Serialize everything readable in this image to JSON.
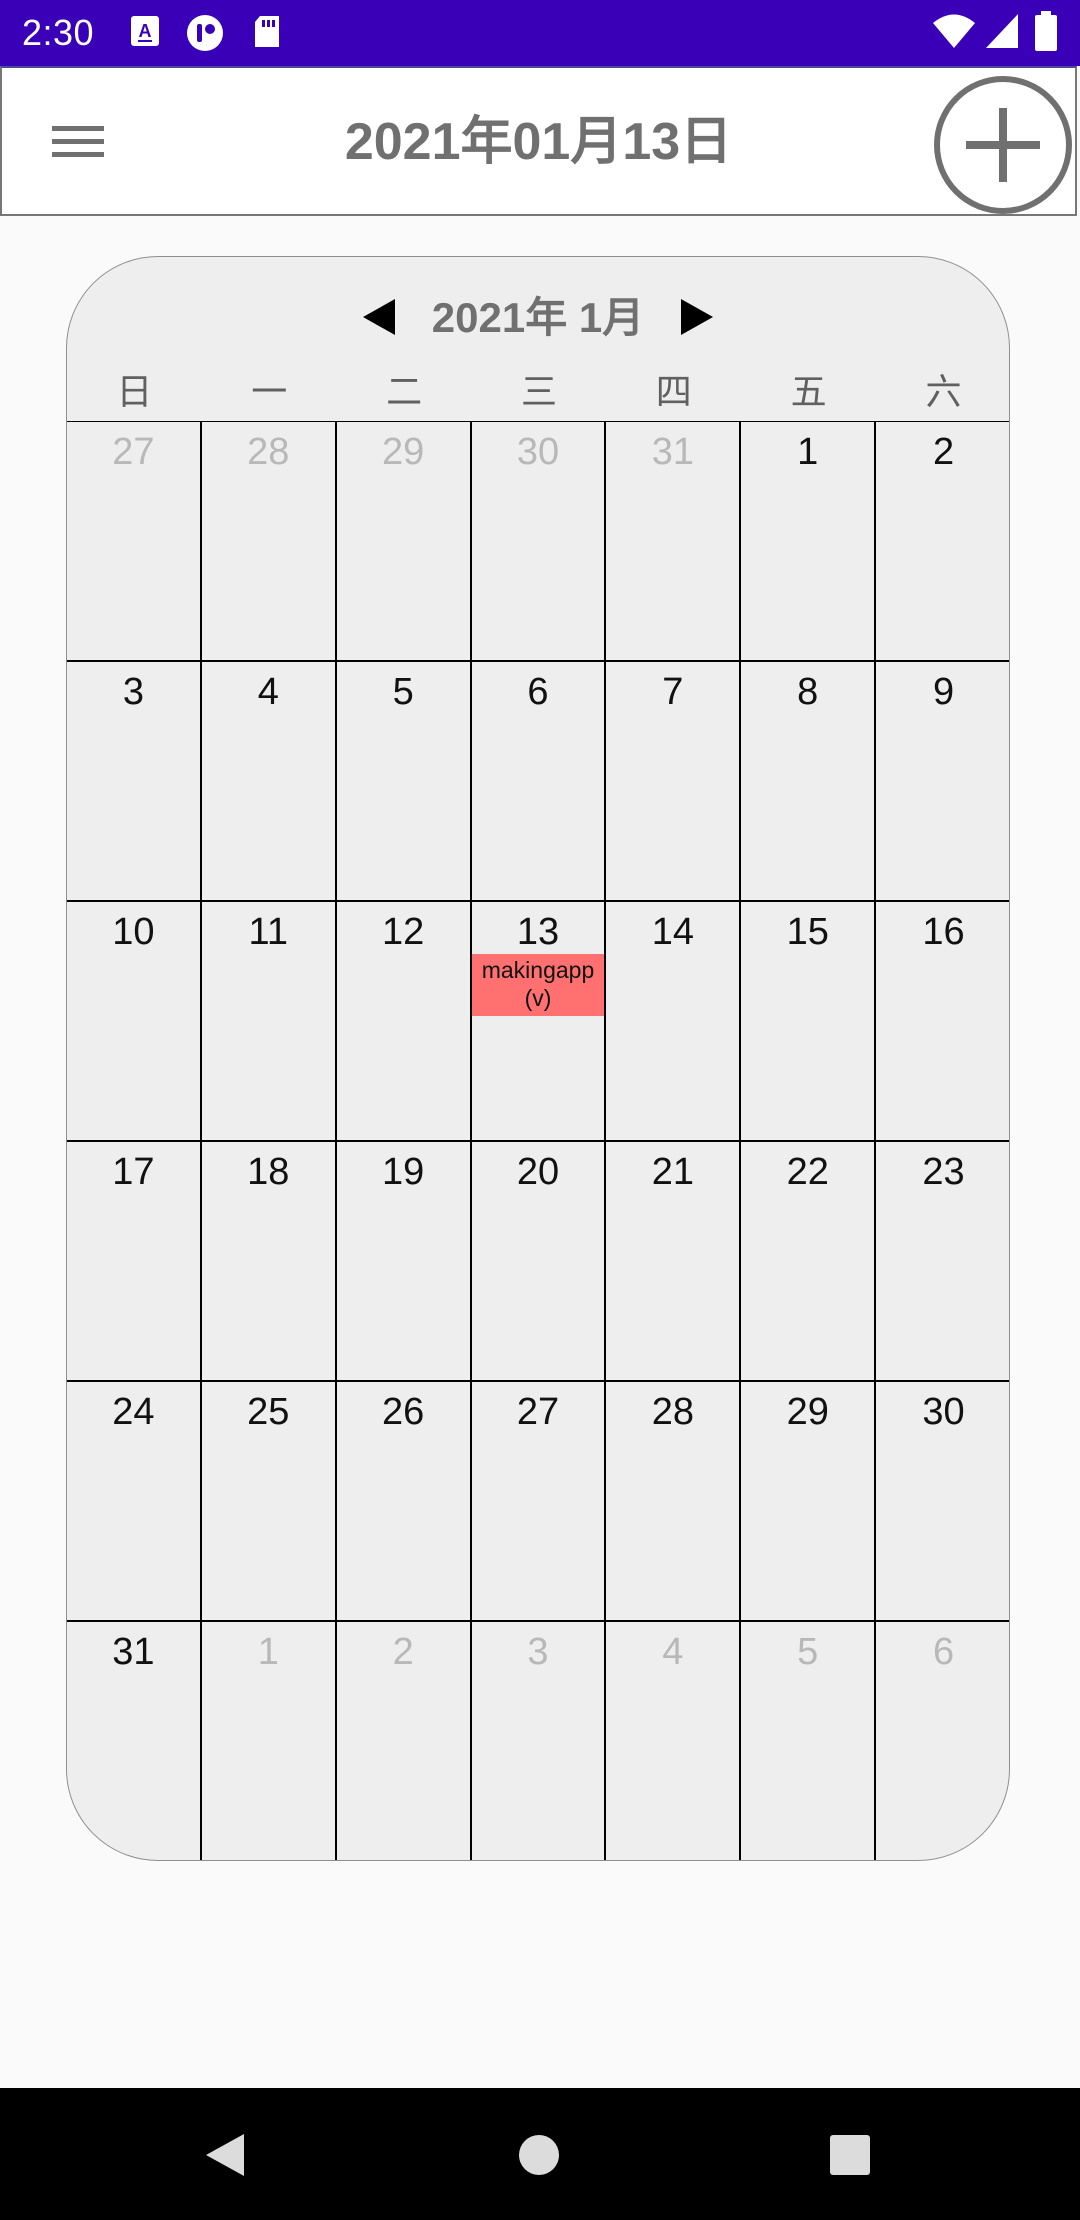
{
  "status_bar": {
    "time": "2:30",
    "icons": [
      "keyboard-a-icon",
      "app-notification-icon",
      "sd-card-icon",
      "wifi-icon",
      "cell-signal-icon",
      "battery-icon"
    ]
  },
  "app_bar": {
    "title": "2021年01月13日",
    "menu_icon": "hamburger-menu-icon",
    "add_icon": "plus-circle-icon"
  },
  "calendar": {
    "month_label": "2021年 1月",
    "prev_icon": "triangle-left-icon",
    "next_icon": "triangle-right-icon",
    "weekdays": [
      "日",
      "一",
      "二",
      "三",
      "四",
      "五",
      "六"
    ],
    "days": [
      {
        "label": "27",
        "other": true
      },
      {
        "label": "28",
        "other": true
      },
      {
        "label": "29",
        "other": true
      },
      {
        "label": "30",
        "other": true
      },
      {
        "label": "31",
        "other": true
      },
      {
        "label": "1"
      },
      {
        "label": "2"
      },
      {
        "label": "3"
      },
      {
        "label": "4"
      },
      {
        "label": "5"
      },
      {
        "label": "6"
      },
      {
        "label": "7"
      },
      {
        "label": "8"
      },
      {
        "label": "9"
      },
      {
        "label": "10"
      },
      {
        "label": "11"
      },
      {
        "label": "12"
      },
      {
        "label": "13",
        "event": "makingapp(v)"
      },
      {
        "label": "14"
      },
      {
        "label": "15"
      },
      {
        "label": "16"
      },
      {
        "label": "17"
      },
      {
        "label": "18"
      },
      {
        "label": "19"
      },
      {
        "label": "20"
      },
      {
        "label": "21"
      },
      {
        "label": "22"
      },
      {
        "label": "23"
      },
      {
        "label": "24"
      },
      {
        "label": "25"
      },
      {
        "label": "26"
      },
      {
        "label": "27"
      },
      {
        "label": "28"
      },
      {
        "label": "29"
      },
      {
        "label": "30"
      },
      {
        "label": "31"
      },
      {
        "label": "1",
        "other": true
      },
      {
        "label": "2",
        "other": true
      },
      {
        "label": "3",
        "other": true
      },
      {
        "label": "4",
        "other": true
      },
      {
        "label": "5",
        "other": true
      },
      {
        "label": "6",
        "other": true
      }
    ]
  },
  "nav_bar": {
    "icons": [
      "back-icon",
      "home-icon",
      "recents-icon"
    ]
  },
  "colors": {
    "status_bar": "#3a00b8",
    "event": "#ff7070",
    "calendar_bg": "#eeeeee",
    "other_month_text": "#b8b8b8"
  }
}
